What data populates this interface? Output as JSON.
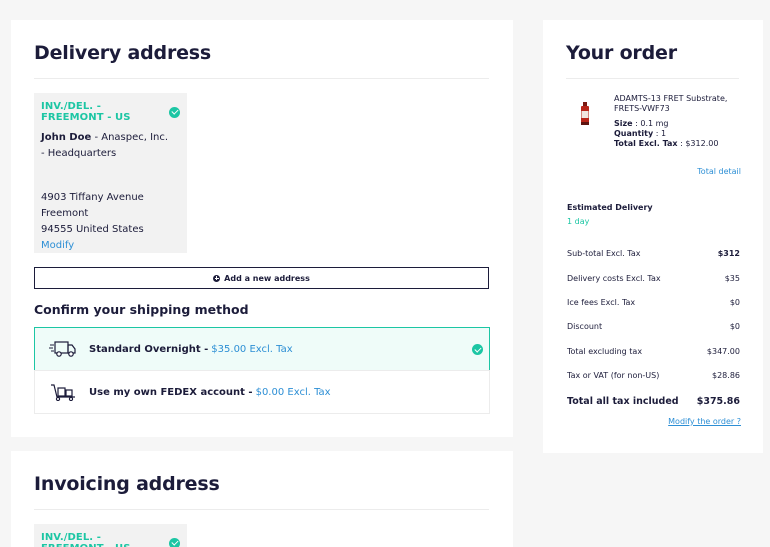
{
  "delivery": {
    "title": "Delivery address",
    "address": {
      "header": "INV./DEL. - FREEMONT - US",
      "name": "John Doe",
      "company": " - Anaspec, Inc.",
      "department": "- Headquarters",
      "street": "4903 Tiffany Avenue",
      "city": "Freemont",
      "zip_country": "94555 United States",
      "modify_label": "Modify"
    },
    "add_address_label": "Add a new address",
    "shipping_title": "Confirm your shipping method",
    "shipping_options": [
      {
        "name": "Standard Overnight - ",
        "price": "$35.00 Excl. Tax",
        "selected": true
      },
      {
        "name": "Use my own FEDEX account - ",
        "price": "$0.00 Excl. Tax",
        "selected": false
      }
    ]
  },
  "invoicing": {
    "title": "Invoicing address",
    "address_header": "INV./DEL. - FREEMONT - US"
  },
  "order": {
    "title": "Your order",
    "item": {
      "name": "ADAMTS-13 FRET Substrate, FRETS-VWF73",
      "size_label": "Size",
      "size_value": " : 0.1 mg",
      "quantity_label": "Quantity",
      "quantity_value": " : 1",
      "total_label": "Total Excl. Tax",
      "total_value": " : $312.00"
    },
    "total_detail_label": "Total detail",
    "estimated_delivery_label": "Estimated Delivery",
    "estimated_delivery_value": "1 day",
    "summary": [
      {
        "label": "Sub-total Excl. Tax",
        "value": "$312"
      },
      {
        "label": "Delivery costs Excl. Tax",
        "value": "$35"
      },
      {
        "label": "Ice fees Excl. Tax",
        "value": "$0"
      },
      {
        "label": "Discount",
        "value": "$0"
      },
      {
        "label": "Total excluding tax",
        "value": "$347.00"
      },
      {
        "label": "Tax or VAT (for non-US)",
        "value": "$28.86"
      },
      {
        "label": "Total all tax included",
        "value": "$375.86"
      }
    ],
    "modify_order_label": "Modify the order ?"
  },
  "colors": {
    "accent_green": "#1cc6a4",
    "link_blue": "#2d8fd5",
    "text_navy": "#1c1c3a"
  }
}
